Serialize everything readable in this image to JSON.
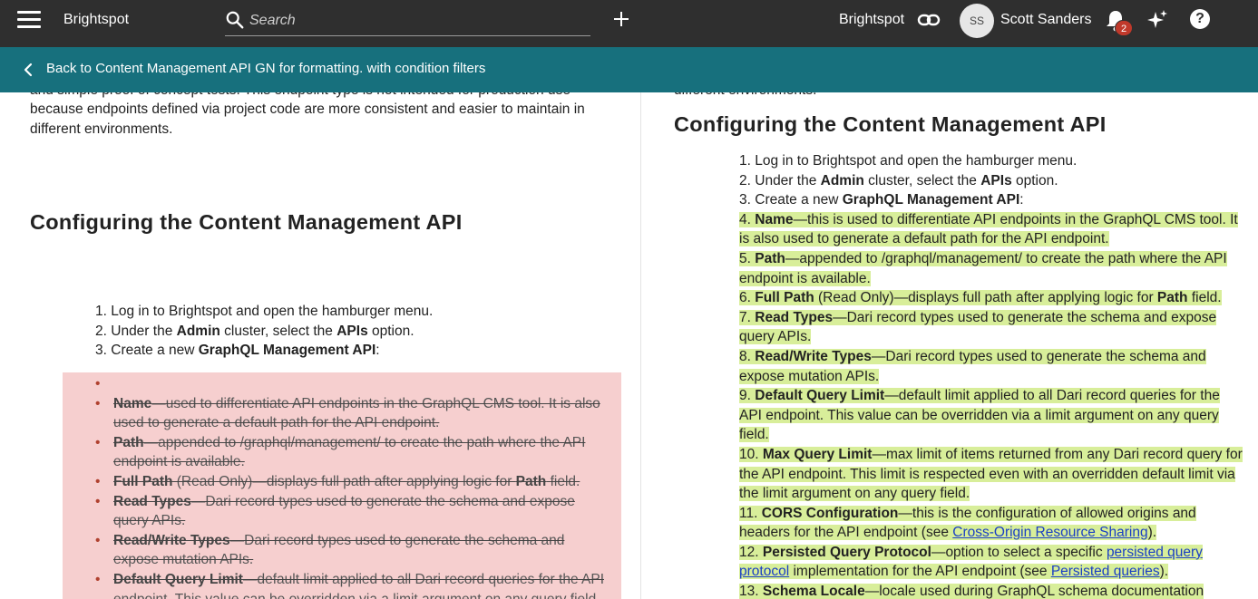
{
  "topbar": {
    "brand": "Brightspot",
    "search_placeholder": "Search",
    "site": "Brightspot",
    "avatar_initials": "SS",
    "user_name": "Scott Sanders",
    "notification_count": "2",
    "help_glyph": "?"
  },
  "backbar": {
    "label": "Back to Content Management API GN for formatting. with condition filters"
  },
  "left": {
    "intro_partial_1": "and simple proof of concept tests. This endpoint type is not intended for production use",
    "intro_line_2": "because endpoints defined via project code are more consistent and easier to maintain in",
    "intro_line_3": "different environments.",
    "heading": "Configuring the Content Management API",
    "steps": [
      {
        "n": "1.",
        "pre": "Log in to Brightspot and open the hamburger menu.",
        "b1": "",
        "mid": "",
        "b2": "",
        "post": ""
      },
      {
        "n": "2.",
        "pre": "Under the ",
        "b1": "Admin",
        "mid": " cluster, select the ",
        "b2": "APIs",
        "post": " option."
      },
      {
        "n": "3.",
        "pre": "Create a new ",
        "b1": "GraphQL Management API",
        "mid": ":",
        "b2": "",
        "post": ""
      }
    ],
    "deleted": [
      {
        "b": "Name",
        "t": "—used to differentiate API endpoints in the GraphQL CMS tool. It is also used to generate a default path for the API endpoint."
      },
      {
        "b": "Path",
        "t": "—appended to /graphql/management/ to create the path where the API endpoint is available."
      },
      {
        "b": "Full Path",
        "t": " (Read Only)—displays full path after applying logic for ",
        "b2": "Path",
        "t2": " field."
      },
      {
        "b": "Read Types",
        "t": "—Dari record types used to generate the schema and expose query APIs."
      },
      {
        "b": "Read/Write Types",
        "t": "—Dari record types used to generate the schema and expose mutation APIs."
      },
      {
        "b": "Default Query Limit",
        "t": "—default limit applied to all Dari record queries for the API endpoint. This value can be overridden via a limit argument on any query field."
      }
    ]
  },
  "right": {
    "intro_partial": "different environments.",
    "heading": "Configuring the Content Management API",
    "steps": [
      {
        "n": "1.",
        "pre": "Log in to Brightspot and open the hamburger menu."
      },
      {
        "n": "2.",
        "pre": "Under the ",
        "b1": "Admin",
        "mid": " cluster, select the ",
        "b2": "APIs",
        "post": " option."
      },
      {
        "n": "3.",
        "pre": "Create a new ",
        "b1": "GraphQL Management API",
        "mid": ":"
      }
    ],
    "inserted": [
      {
        "n": "4.",
        "b": "Name",
        "t": "—this is used to differentiate API endpoints in the GraphQL CMS tool. It is also used to generate a default path for the API endpoint."
      },
      {
        "n": "5.",
        "b": "Path",
        "t": "—appended to /graphql/management/ to create the path where the API endpoint is available."
      },
      {
        "n": "6.",
        "b": "Full Path",
        "t": " (Read Only)—displays full path after applying logic for ",
        "b2": "Path",
        "t2": " field."
      },
      {
        "n": "7.",
        "b": "Read Types",
        "t": "—Dari record types used to generate the schema and expose query APIs."
      },
      {
        "n": "8.",
        "b": "Read/Write Types",
        "t": "—Dari record types used to generate the schema and expose mutation APIs."
      },
      {
        "n": "9.",
        "b": "Default Query Limit",
        "t": "—default limit applied to all Dari record queries for the API endpoint. This value can be overridden via a limit argument on any query field."
      },
      {
        "n": "10.",
        "b": "Max Query Limit",
        "t": "—max limit of items returned from any Dari record query for the API endpoint. This limit is respected even with an overridden default limit via the limit argument on any query field."
      },
      {
        "n": "11.",
        "b": "CORS Configuration",
        "t": "—this is the configuration of allowed origins and headers for the API endpoint (see ",
        "link1": "Cross-Origin Resource Sharing",
        "t2": ")."
      },
      {
        "n": "12.",
        "b": "Persisted Query Protocol",
        "t": "—option to select a specific ",
        "link1": "persisted query protocol",
        "t2": " implementation for the API endpoint (see ",
        "link2": "Persisted queries",
        "t3": ")."
      },
      {
        "n": "13.",
        "b": "Schema Locale",
        "t": "—locale used during GraphQL schema documentation generation."
      }
    ]
  },
  "colors": {
    "topbar": "#2f2f2f",
    "backbar": "#17707d",
    "deleted_bg": "#f6cfcf",
    "inserted_highlight": "#d8ee9a",
    "link": "#1a3fc4"
  }
}
